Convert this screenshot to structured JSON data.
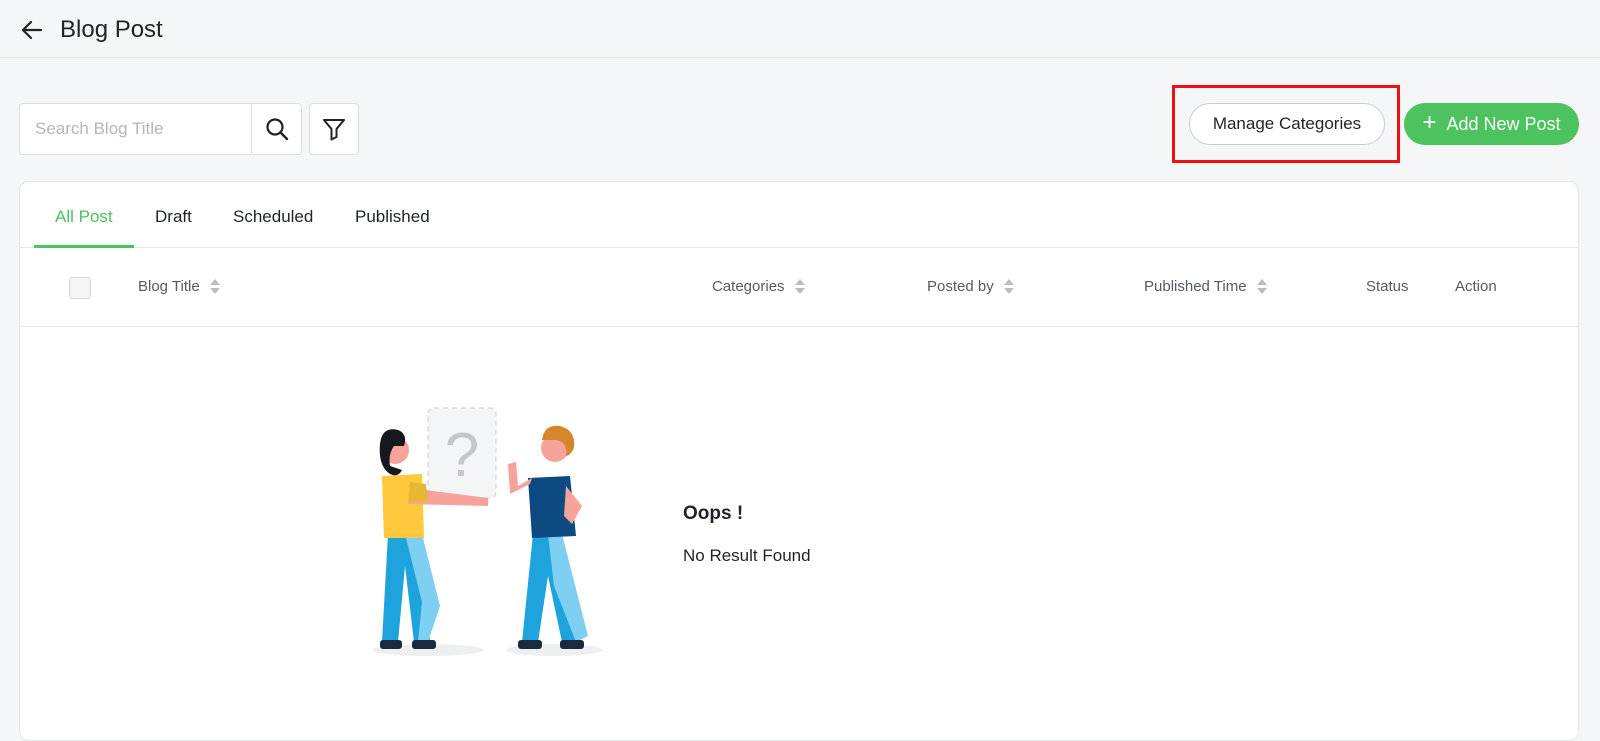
{
  "header": {
    "title": "Blog Post",
    "back_icon": "arrow-left-icon"
  },
  "toolbar": {
    "search_placeholder": "Search Blog Title",
    "search_value": "",
    "search_icon": "search-icon",
    "filter_icon": "filter-icon",
    "manage_categories_label": "Manage Categories",
    "add_new_post_label": "Add New Post",
    "add_icon": "plus-icon"
  },
  "tabs": [
    {
      "label": "All Post",
      "active": true
    },
    {
      "label": "Draft",
      "active": false
    },
    {
      "label": "Scheduled",
      "active": false
    },
    {
      "label": "Published",
      "active": false
    }
  ],
  "table": {
    "columns": [
      {
        "label": "Blog Title",
        "sortable": true
      },
      {
        "label": "Categories",
        "sortable": true
      },
      {
        "label": "Posted by",
        "sortable": true
      },
      {
        "label": "Published Time",
        "sortable": true
      },
      {
        "label": "Status",
        "sortable": false
      },
      {
        "label": "Action",
        "sortable": false
      }
    ],
    "rows": []
  },
  "empty_state": {
    "title": "Oops !",
    "message": "No Result Found",
    "illustration": "two-people-question-illustration"
  },
  "colors": {
    "accent": "#4cc35f",
    "highlight": "#ee1111",
    "background": "#f5f6f8"
  }
}
